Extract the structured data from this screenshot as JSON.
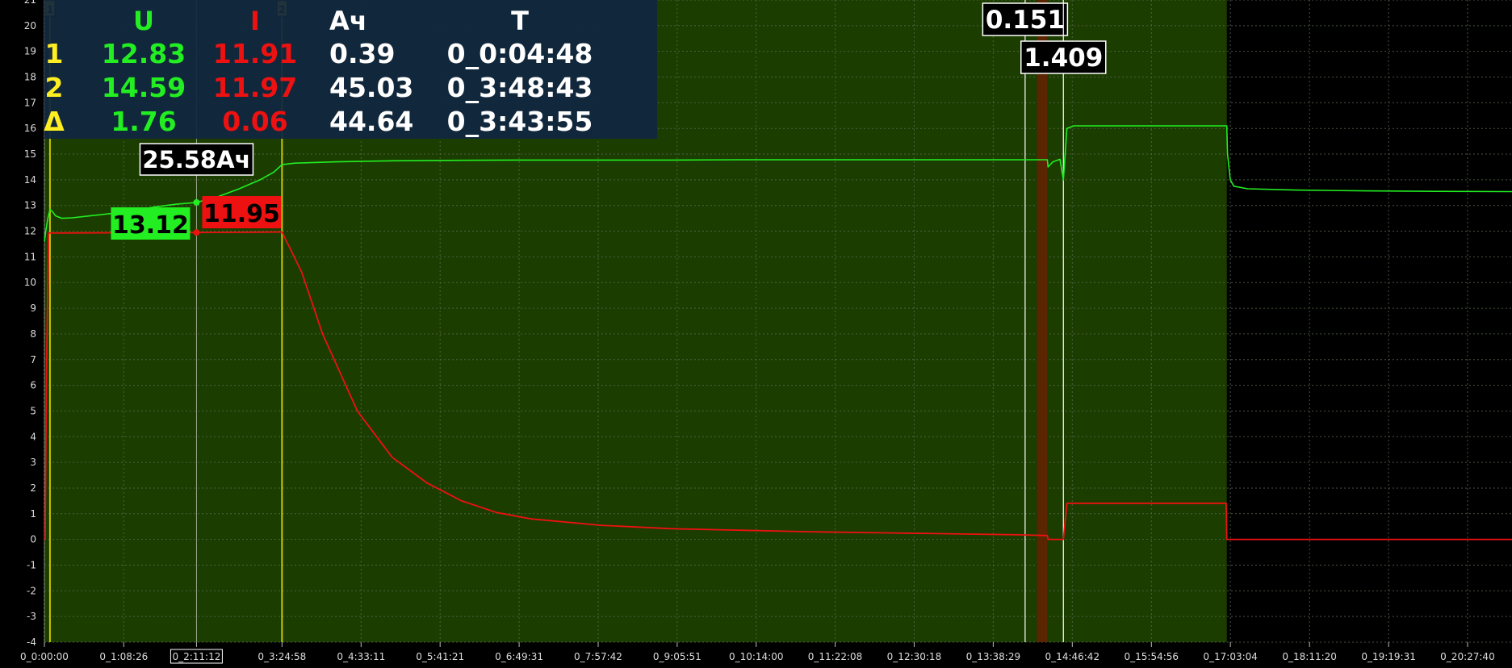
{
  "colors": {
    "plot_bg": "#1b3d00",
    "outer_bg": "#000000",
    "voltage": "#22ee22",
    "current": "#ee1111",
    "cursor": "#c8c800",
    "marker_fill": "#5a2500"
  },
  "chart_data": {
    "type": "line",
    "grid": true,
    "ylim": [
      -4,
      21
    ],
    "y_ticks": [
      "-4",
      "-3",
      "-2",
      "-1",
      "0",
      "1",
      "2",
      "3",
      "4",
      "5",
      "6",
      "7",
      "8",
      "9",
      "10",
      "11",
      "12",
      "13",
      "14",
      "15",
      "16",
      "17",
      "18",
      "19",
      "20",
      "21"
    ],
    "x_ticks": [
      "0_0:00:00",
      "0_1:08:26",
      "0_2:11:12",
      "0_3:24:58",
      "0_4:33:11",
      "0_5:41:21",
      "0_6:49:31",
      "0_7:57:42",
      "0_9:05:51",
      "0_10:14:00",
      "0_11:22:08",
      "0_12:30:18",
      "0_13:38:29",
      "0_14:46:42",
      "0_15:54:56",
      "0_17:03:04",
      "0_18:11:20",
      "0_19:19:31",
      "0_20:27:40"
    ],
    "x_hours": [
      0,
      1.1406,
      2.1867,
      3.4161,
      4.5531,
      5.6892,
      6.8253,
      7.9617,
      9.0975,
      10.2333,
      11.3689,
      12.505,
      13.6414,
      14.7783,
      15.9156,
      17.0511,
      18.1889,
      19.3253,
      20.4611
    ],
    "xlim_hours": [
      0,
      21.1
    ],
    "recorded_region_hours": [
      0,
      17.0
    ],
    "series": [
      {
        "key": "voltage",
        "x": [
          0,
          0.02,
          0.05,
          0.08,
          0.12,
          0.16,
          0.25,
          0.4,
          0.6,
          0.8,
          1.0,
          1.3,
          1.6,
          1.9,
          2.187,
          2.5,
          2.8,
          3.1,
          3.3,
          3.416,
          3.6,
          4.2,
          5,
          6,
          7,
          8,
          9,
          10,
          11,
          12,
          13,
          14.1,
          14.42,
          14.43,
          14.5,
          14.6,
          14.65,
          14.7,
          14.8,
          15,
          16,
          16.99,
          17.0,
          17.01,
          17.05,
          17.1,
          17.3,
          18,
          19,
          20,
          21.1
        ],
        "y": [
          11.6,
          12.0,
          12.5,
          12.85,
          12.75,
          12.6,
          12.5,
          12.52,
          12.58,
          12.64,
          12.7,
          12.82,
          12.95,
          13.05,
          13.12,
          13.35,
          13.65,
          14.0,
          14.3,
          14.59,
          14.65,
          14.7,
          14.74,
          14.76,
          14.77,
          14.77,
          14.77,
          14.78,
          14.78,
          14.78,
          14.78,
          14.78,
          14.78,
          14.5,
          14.7,
          14.8,
          14.0,
          16.0,
          16.1,
          16.1,
          16.1,
          16.1,
          16.1,
          15.0,
          14.0,
          13.75,
          13.65,
          13.6,
          13.57,
          13.55,
          13.54
        ]
      },
      {
        "key": "current",
        "x": [
          0,
          0.01,
          0.03,
          0.06,
          0.1,
          1.0,
          2.187,
          3.0,
          3.416,
          3.7,
          4.0,
          4.5,
          5,
          5.5,
          6,
          6.5,
          7,
          8,
          9,
          10,
          11,
          12,
          13,
          14,
          14.42,
          14.43,
          14.65,
          14.7,
          16.99,
          17.0,
          21.1
        ],
        "y": [
          0,
          0,
          6.5,
          11.93,
          11.93,
          11.94,
          11.95,
          11.96,
          11.97,
          10.4,
          8.0,
          5.0,
          3.2,
          2.2,
          1.5,
          1.05,
          0.8,
          0.55,
          0.42,
          0.36,
          0.3,
          0.26,
          0.22,
          0.18,
          0.151,
          0,
          0,
          1.409,
          1.409,
          0,
          0
        ]
      }
    ],
    "cursors": [
      {
        "id": "1",
        "x_hours": 0.08
      },
      {
        "id": "2",
        "x_hours": 3.416
      }
    ],
    "hover_x_hours": 2.187,
    "hover_x_label": "0_2:11:12",
    "hover_values": {
      "ah": "25.58Ач",
      "voltage": "13.12",
      "current": "11.95",
      "voltage_at": 13.12,
      "current_at": 11.95
    },
    "markers": [
      {
        "x_hours": 14.1,
        "label": "0.151"
      },
      {
        "x_hours": 14.65,
        "label": "1.409"
      }
    ],
    "marker_band_hours": [
      14.27,
      14.42
    ],
    "readout_table": {
      "headers": [
        "",
        "U",
        "I",
        "Ач",
        "T"
      ],
      "rows": [
        {
          "label": "1",
          "u": "12.83",
          "i": "11.91",
          "ah": "0.39",
          "t": "0_0:04:48"
        },
        {
          "label": "2",
          "u": "14.59",
          "i": "11.97",
          "ah": "45.03",
          "t": "0_3:48:43"
        },
        {
          "label": "Δ",
          "u": "1.76",
          "i": "0.06",
          "ah": "44.64",
          "t": "0_3:43:55"
        }
      ]
    }
  }
}
